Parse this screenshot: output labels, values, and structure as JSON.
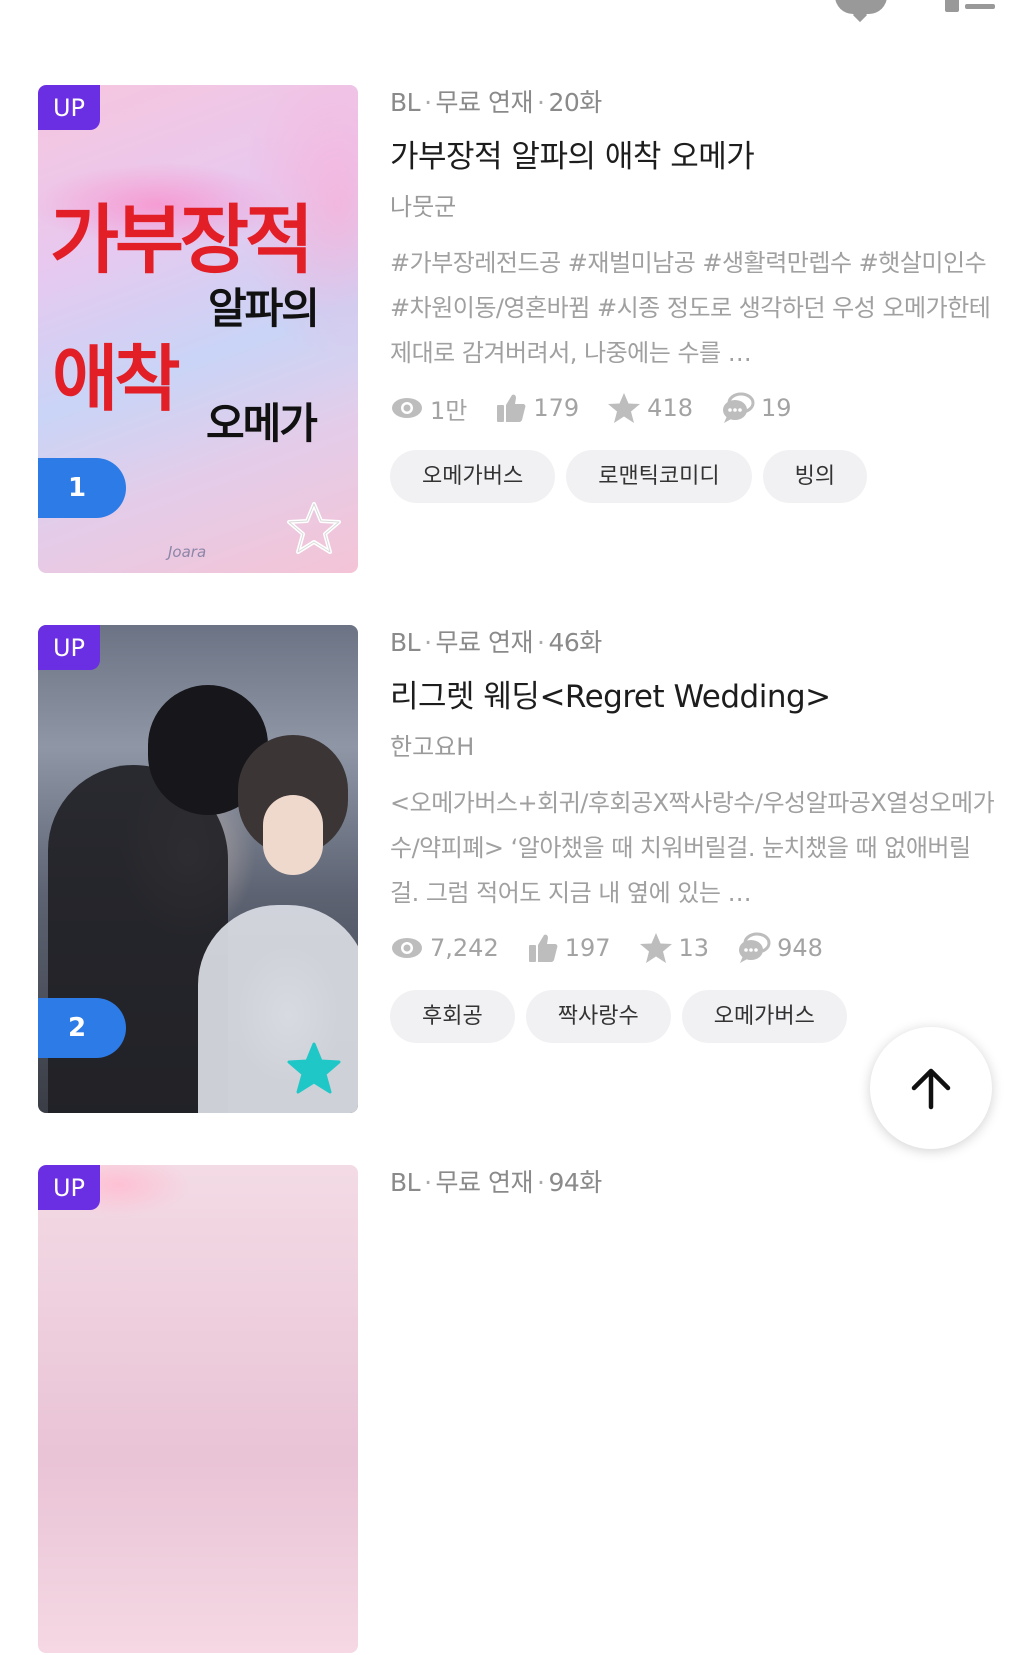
{
  "items": [
    {
      "badge_up": "UP",
      "rank": "1",
      "cover_text": [
        "가부장적",
        "알파의",
        "애착",
        "오메가"
      ],
      "cover_logo": "Joara",
      "genre": "BL",
      "status": "무료 연재",
      "episodes": "20화",
      "title": "가부장적 알파의 애착 오메가",
      "author": "나뭇군",
      "description": "#가부장레전드공 #재벌미남공 #생활력만렙수 #햇살미인수 #차원이동/영혼바뀜 #시종 정도로 생각하던 우성 오메가한테 제대로 감겨버려서, 나중에는 수를 …",
      "stats": {
        "views": "1만",
        "likes": "179",
        "stars": "418",
        "comments": "19"
      },
      "tags": [
        "오메가버스",
        "로맨틱코미디",
        "빙의"
      ],
      "favorited": false
    },
    {
      "badge_up": "UP",
      "rank": "2",
      "genre": "BL",
      "status": "무료 연재",
      "episodes": "46화",
      "title": "리그렛 웨딩<Regret Wedding>",
      "author": "한고요H",
      "description": "<오메가버스+회귀/후회공X짝사랑수/우성알파공X열성오메가수/약피폐> ‘알아챘을 때 치워버릴걸. 눈치챘을 때 없애버릴걸. 그럼 적어도 지금 내 옆에 있는 …",
      "stats": {
        "views": "7,242",
        "likes": "197",
        "stars": "13",
        "comments": "948"
      },
      "tags": [
        "후회공",
        "짝사랑수",
        "오메가버스"
      ],
      "favorited": true
    },
    {
      "badge_up": "UP",
      "genre": "BL",
      "status": "무료 연재",
      "episodes": "94화"
    }
  ],
  "icons": {
    "top_left": "chat-icon",
    "top_right": "list-view-icon",
    "views": "eye-icon",
    "likes": "thumbs-up-icon",
    "stars": "star-icon",
    "comments": "comment-icon",
    "scroll_top": "arrow-up-icon"
  },
  "colors": {
    "up_badge": "#6b2fe3",
    "rank_badge": "#2d7be6",
    "favorite_star": "#1fc7c7",
    "tag_bg": "#f1f1f3"
  }
}
